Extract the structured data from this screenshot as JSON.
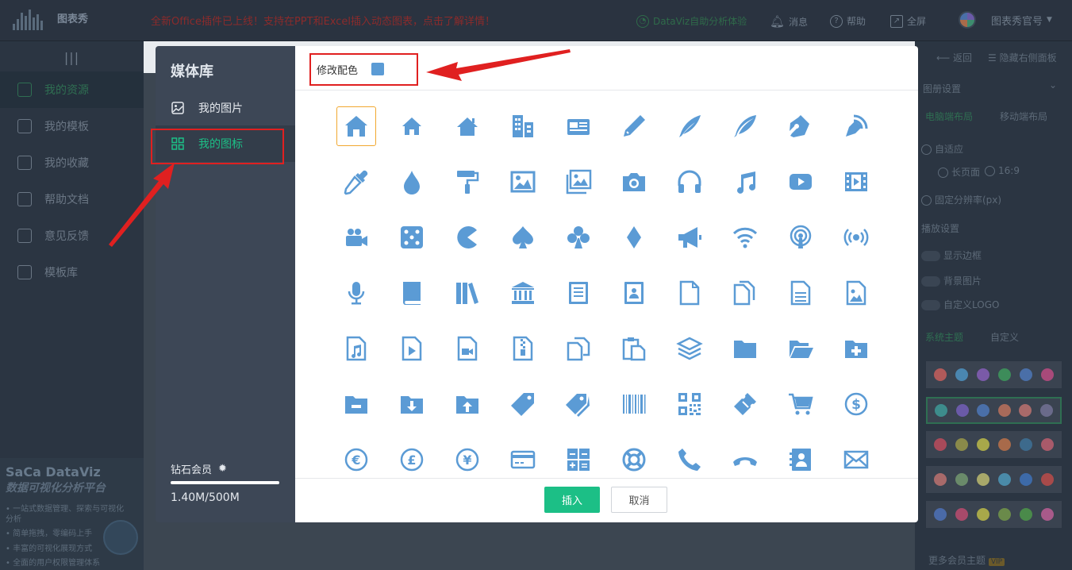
{
  "topbar": {
    "logo_text": "图表秀",
    "notice": "全新Office插件已上线！支持在PPT和Excel插入动态图表，点击了解详情！",
    "dataviz_trial": "DataViz自助分析体验",
    "message": "消息",
    "help": "帮助",
    "fullscreen": "全屏",
    "user": "图表秀官号"
  },
  "left_nav": {
    "items": [
      {
        "label": "我的资源",
        "icon": "document-icon"
      },
      {
        "label": "我的模板",
        "icon": "template-icon"
      },
      {
        "label": "我的收藏",
        "icon": "star-icon"
      },
      {
        "label": "帮助文档",
        "icon": "help-doc-icon"
      },
      {
        "label": "意见反馈",
        "icon": "feedback-icon"
      },
      {
        "label": "模板库",
        "icon": "template-library-icon"
      }
    ],
    "promo": {
      "title": "SaCa DataViz",
      "subtitle": "数据可视化分析平台",
      "lines": [
        "• 一站式数据管理、探索与可视化",
        "  分析",
        "• 简单拖拽，零编码上手",
        "• 丰富的可视化展现方式",
        "• 全面的用户权限管理体系"
      ]
    }
  },
  "right_panel": {
    "back": "返回",
    "hide": "隐藏右侧面板",
    "section_title": "图册设置",
    "tabs": [
      "电脑端布局",
      "移动端布局"
    ],
    "adaptive": "自适应",
    "landscape": "长页面",
    "ratio": "16:9",
    "fixed_resolution": "固定分辨率(px)",
    "playback_title": "播放设置",
    "toggles": [
      "显示边框",
      "背景图片",
      "自定义LOGO"
    ],
    "theme_tabs": [
      "系统主题",
      "自定义"
    ],
    "more_themes": "更多会员主题",
    "vip": "VIP",
    "theme_rows": [
      [
        "#b05a5a",
        "#4a86b0",
        "#7a5aa8",
        "#3d8c5a",
        "#4a6fa8",
        "#a84a7a"
      ],
      [
        "#3d8c8c",
        "#6a5aa8",
        "#4a6fa8",
        "#a86a5a",
        "#a86a6a",
        "#6a6a8a"
      ],
      [
        "#a84a5a",
        "#8a8a4a",
        "#a8a84a",
        "#a86a4a",
        "#3d6a8c",
        "#a85a6a"
      ],
      [
        "#a86a6a",
        "#6a8a6a",
        "#a8a86a",
        "#4a8aa8",
        "#3d6aa8",
        "#a84a4a"
      ],
      [
        "#4a6aa8",
        "#a84a6a",
        "#a8a84a",
        "#6a8a4a",
        "#4a8a4a",
        "#a85a8a"
      ]
    ]
  },
  "modal": {
    "title": "媒体库",
    "menu": [
      {
        "label": "我的图片",
        "icon": "image-icon"
      },
      {
        "label": "我的图标",
        "icon": "grid-icon"
      }
    ],
    "member": "钻石会员",
    "storage": "1.40M/500M",
    "storage_fraction": 0.0028,
    "color_label": "修改配色",
    "icon_color": "#5b9bd5",
    "insert": "插入",
    "cancel": "取消",
    "icons": [
      [
        "home-icon",
        "home-small-icon",
        "home-alt-icon",
        "building-icon",
        "newspaper-icon",
        "pencil-icon",
        "quill-icon",
        "feather-icon",
        "pen-icon",
        "blog-icon"
      ],
      [
        "eyedropper-icon",
        "droplet-icon",
        "paint-roller-icon",
        "image-icon",
        "images-icon",
        "camera-icon",
        "headphones-icon",
        "music-icon",
        "play-icon",
        "film-icon"
      ],
      [
        "video-camera-icon",
        "dice-icon",
        "pacman-icon",
        "spade-icon",
        "club-icon",
        "diamond-icon",
        "bullhorn-icon",
        "wifi-icon",
        "podcast-icon",
        "broadcast-icon"
      ],
      [
        "microphone-icon",
        "book-icon",
        "books-icon",
        "library-icon",
        "file-text-icon",
        "profile-icon",
        "file-empty-icon",
        "files-icon",
        "file-lines-icon",
        "file-picture-icon"
      ],
      [
        "file-music-icon",
        "file-play-icon",
        "file-video-icon",
        "file-zip-icon",
        "copy-icon",
        "paste-icon",
        "stack-icon",
        "folder-icon",
        "folder-open-icon",
        "folder-plus-icon"
      ],
      [
        "folder-minus-icon",
        "folder-download-icon",
        "folder-upload-icon",
        "price-tag-icon",
        "price-tags-icon",
        "barcode-icon",
        "qrcode-icon",
        "ticket-icon",
        "cart-icon",
        "coin-dollar-icon"
      ],
      [
        "coin-euro-icon",
        "coin-pound-icon",
        "coin-yen-icon",
        "credit-card-icon",
        "calculator-icon",
        "lifebuoy-icon",
        "phone-icon",
        "phone-hang-up-icon",
        "address-book-icon",
        "envelope-icon"
      ]
    ]
  }
}
